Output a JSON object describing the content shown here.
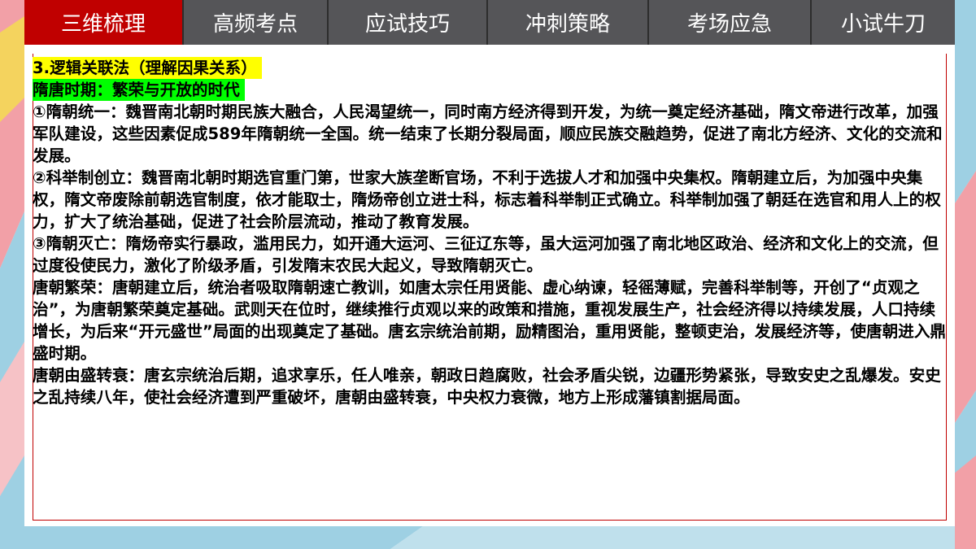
{
  "tabs": [
    "三维梳理",
    "高频考点",
    "应试技巧",
    "冲刺策略",
    "考场应急",
    "小试牛刀"
  ],
  "active_tab": "三维梳理",
  "colors": {
    "accent": "#c00000",
    "tab_bg": "#555558",
    "highlight_title": "#ffff00",
    "highlight_subtitle": "#00ff00",
    "deco_blue": "#9ed0e3",
    "deco_pink": "#f2a0a7",
    "deco_yellow": "#f4d35e"
  },
  "content": {
    "title": "3.逻辑关联法（理解因果关系）",
    "subtitle": "隋唐时期：繁荣与开放的时代",
    "paragraphs": [
      "①隋朝统一：魏晋南北朝时期民族大融合，人民渴望统一，同时南方经济得到开发，为统一奠定经济基础，隋文帝进行改革，加强军队建设，这些因素促成589年隋朝统一全国。统一结束了长期分裂局面，顺应民族交融趋势，促进了南北方经济、文化的交流和发展。",
      "②科举制创立：魏晋南北朝时期选官重门第，世家大族垄断官场，不利于选拔人才和加强中央集权。隋朝建立后，为加强中央集权，隋文帝废除前朝选官制度，依才能取士，隋炀帝创立进士科，标志着科举制正式确立。科举制加强了朝廷在选官和用人上的权力，扩大了统治基础，促进了社会阶层流动，推动了教育发展。",
      "③隋朝灭亡：隋炀帝实行暴政，滥用民力，如开通大运河、三征辽东等，虽大运河加强了南北地区政治、经济和文化上的交流，但过度役使民力，激化了阶级矛盾，引发隋末农民大起义，导致隋朝灭亡。",
      "唐朝繁荣：唐朝建立后，统治者吸取隋朝速亡教训，如唐太宗任用贤能、虚心纳谏，轻徭薄赋，完善科举制等，开创了“贞观之治”，为唐朝繁荣奠定基础。武则天在位时，继续推行贞观以来的政策和措施，重视发展生产，社会经济得以持续发展，人口持续增长，为后来“开元盛世”局面的出现奠定了基础。唐玄宗统治前期，励精图治，重用贤能，整顿吏治，发展经济等，使唐朝进入鼎盛时期。",
      "唐朝由盛转衰：唐玄宗统治后期，追求享乐，任人唯亲，朝政日趋腐败，社会矛盾尖锐，边疆形势紧张，导致安史之乱爆发。安史之乱持续八年，使社会经济遭到严重破坏，唐朝由盛转衰，中央权力衰微，地方上形成藩镇割据局面。"
    ]
  }
}
